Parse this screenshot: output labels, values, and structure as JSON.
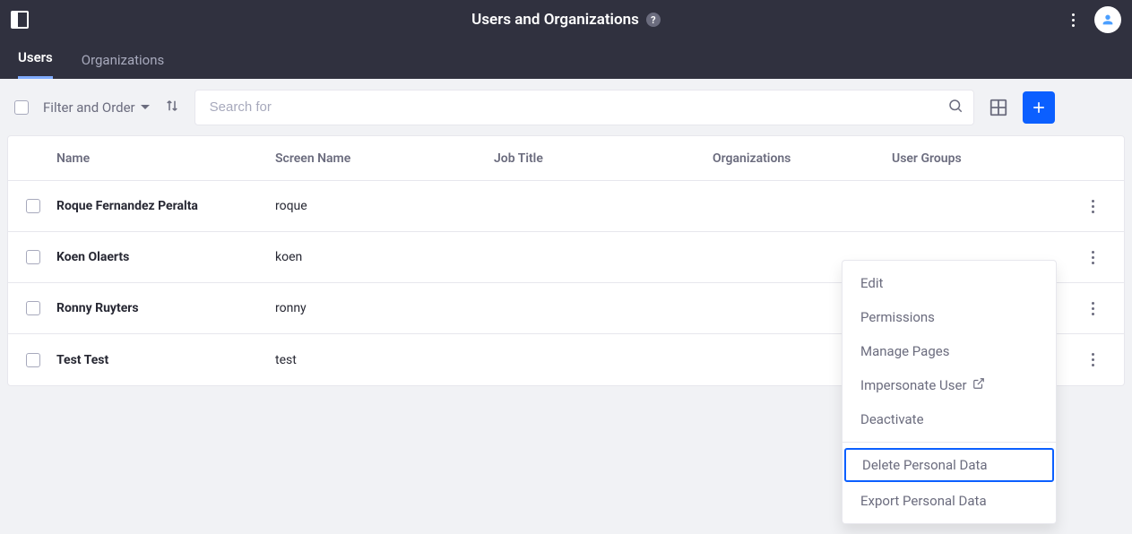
{
  "header": {
    "title": "Users and Organizations",
    "help_icon": "?"
  },
  "tabs": [
    {
      "label": "Users",
      "active": true
    },
    {
      "label": "Organizations",
      "active": false
    }
  ],
  "toolbar": {
    "filter_label": "Filter and Order",
    "search_placeholder": "Search for"
  },
  "table": {
    "columns": {
      "name": "Name",
      "screen_name": "Screen Name",
      "job_title": "Job Title",
      "organizations": "Organizations",
      "user_groups": "User Groups"
    },
    "rows": [
      {
        "name": "Roque Fernandez Peralta",
        "screen_name": "roque",
        "job_title": "",
        "organizations": "",
        "user_groups": ""
      },
      {
        "name": "Koen Olaerts",
        "screen_name": "koen",
        "job_title": "",
        "organizations": "",
        "user_groups": ""
      },
      {
        "name": "Ronny Ruyters",
        "screen_name": "ronny",
        "job_title": "",
        "organizations": "",
        "user_groups": ""
      },
      {
        "name": "Test Test",
        "screen_name": "test",
        "job_title": "",
        "organizations": "",
        "user_groups": ""
      }
    ]
  },
  "row_menu": {
    "edit": "Edit",
    "permissions": "Permissions",
    "manage_pages": "Manage Pages",
    "impersonate": "Impersonate User",
    "deactivate": "Deactivate",
    "delete_personal": "Delete Personal Data",
    "export_personal": "Export Personal Data"
  }
}
